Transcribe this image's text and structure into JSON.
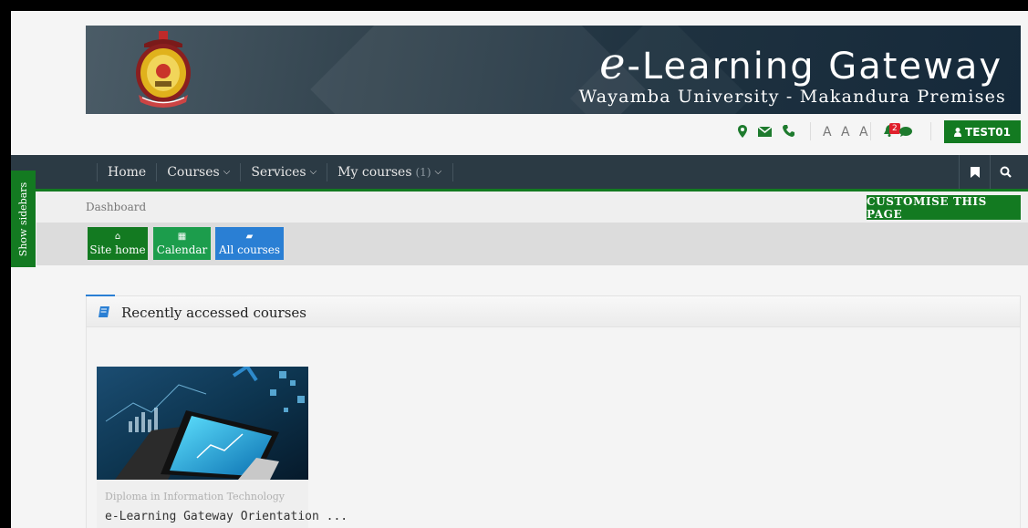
{
  "header": {
    "brand_title_prefix": "e",
    "brand_title_rest": "-Learning Gateway",
    "brand_subtitle": "Wayamba University - Makandura Premises",
    "font_size_controls": "A A A",
    "notification_count": "2",
    "user_label": "TEST01"
  },
  "nav": {
    "items": [
      {
        "label": "Home",
        "has_dropdown": false
      },
      {
        "label": "Courses",
        "has_dropdown": true
      },
      {
        "label": "Services",
        "has_dropdown": true
      },
      {
        "label": "My courses",
        "count": "(1)",
        "has_dropdown": true
      }
    ],
    "right_icons": [
      "bookmark-icon",
      "search-icon"
    ]
  },
  "sidebar_toggle": {
    "label": "Show sidebars"
  },
  "breadcrumb": {
    "current": "Dashboard"
  },
  "customise_button": {
    "label": "CUSTOMISE THIS PAGE"
  },
  "quick_links": [
    {
      "label": "Site home",
      "icon": "home-icon",
      "color": "#137a21"
    },
    {
      "label": "Calendar",
      "icon": "calendar-icon",
      "color": "#1c9d4c"
    },
    {
      "label": "All courses",
      "icon": "book-icon",
      "color": "#2a7fd4"
    }
  ],
  "recent": {
    "title": "Recently accessed courses",
    "courses": [
      {
        "category": "Diploma in Information Technology",
        "name": "e-Learning Gateway Orientation ..."
      }
    ]
  },
  "colors": {
    "accent_green": "#137a21",
    "nav_bg": "#2b3a44",
    "accent_blue": "#2a7fd4"
  }
}
